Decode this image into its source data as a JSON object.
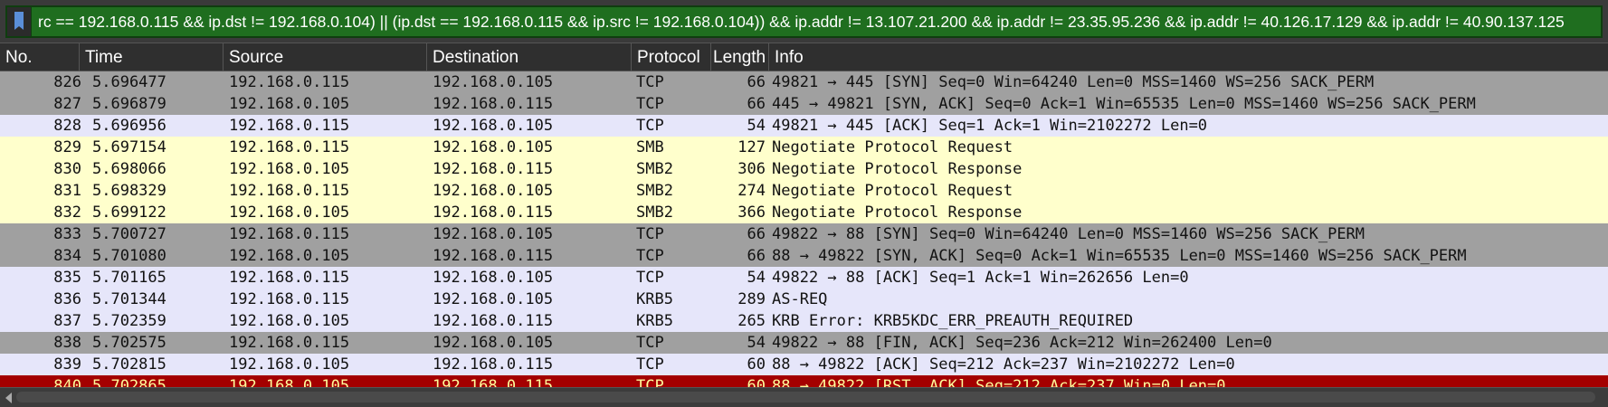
{
  "filter": {
    "text": "rc == 192.168.0.115 && ip.dst != 192.168.0.104) || (ip.dst == 192.168.0.115 && ip.src != 192.168.0.104)) && ip.addr != 13.107.21.200 && ip.addr != 23.35.95.236 && ip.addr != 40.126.17.129 && ip.addr != 40.90.137.125",
    "bookmark_icon": "bookmark-icon",
    "background_color": "#1f6e1f"
  },
  "columns": {
    "no": "No.",
    "time": "Time",
    "source": "Source",
    "destination": "Destination",
    "protocol": "Protocol",
    "length": "Length",
    "info": "Info"
  },
  "colors": {
    "tcp_gray": "#a0a0a0",
    "tcp_lavender": "#e6e6fa",
    "smb_yellow": "#ffffcc",
    "tcp_rst_red": "#a40000",
    "text_dark": "#121212",
    "text_light": "#fffc9c"
  },
  "packets": [
    {
      "no": "826",
      "time": "5.696477",
      "source": "192.168.0.115",
      "destination": "192.168.0.105",
      "protocol": "TCP",
      "length": "66",
      "info": "49821 → 445 [SYN] Seq=0 Win=64240 Len=0 MSS=1460 WS=256 SACK_PERM",
      "bg": "#a0a0a0",
      "fg": "#121212"
    },
    {
      "no": "827",
      "time": "5.696879",
      "source": "192.168.0.105",
      "destination": "192.168.0.115",
      "protocol": "TCP",
      "length": "66",
      "info": "445 → 49821 [SYN, ACK] Seq=0 Ack=1 Win=65535 Len=0 MSS=1460 WS=256 SACK_PERM",
      "bg": "#a0a0a0",
      "fg": "#121212"
    },
    {
      "no": "828",
      "time": "5.696956",
      "source": "192.168.0.115",
      "destination": "192.168.0.105",
      "protocol": "TCP",
      "length": "54",
      "info": "49821 → 445 [ACK] Seq=1 Ack=1 Win=2102272 Len=0",
      "bg": "#e6e6fa",
      "fg": "#121212"
    },
    {
      "no": "829",
      "time": "5.697154",
      "source": "192.168.0.115",
      "destination": "192.168.0.105",
      "protocol": "SMB",
      "length": "127",
      "info": "Negotiate Protocol Request",
      "bg": "#ffffcc",
      "fg": "#121212"
    },
    {
      "no": "830",
      "time": "5.698066",
      "source": "192.168.0.105",
      "destination": "192.168.0.115",
      "protocol": "SMB2",
      "length": "306",
      "info": "Negotiate Protocol Response",
      "bg": "#ffffcc",
      "fg": "#121212"
    },
    {
      "no": "831",
      "time": "5.698329",
      "source": "192.168.0.115",
      "destination": "192.168.0.105",
      "protocol": "SMB2",
      "length": "274",
      "info": "Negotiate Protocol Request",
      "bg": "#ffffcc",
      "fg": "#121212"
    },
    {
      "no": "832",
      "time": "5.699122",
      "source": "192.168.0.105",
      "destination": "192.168.0.115",
      "protocol": "SMB2",
      "length": "366",
      "info": "Negotiate Protocol Response",
      "bg": "#ffffcc",
      "fg": "#121212"
    },
    {
      "no": "833",
      "time": "5.700727",
      "source": "192.168.0.115",
      "destination": "192.168.0.105",
      "protocol": "TCP",
      "length": "66",
      "info": "49822 → 88 [SYN] Seq=0 Win=64240 Len=0 MSS=1460 WS=256 SACK_PERM",
      "bg": "#a0a0a0",
      "fg": "#121212"
    },
    {
      "no": "834",
      "time": "5.701080",
      "source": "192.168.0.105",
      "destination": "192.168.0.115",
      "protocol": "TCP",
      "length": "66",
      "info": "88 → 49822 [SYN, ACK] Seq=0 Ack=1 Win=65535 Len=0 MSS=1460 WS=256 SACK_PERM",
      "bg": "#a0a0a0",
      "fg": "#121212"
    },
    {
      "no": "835",
      "time": "5.701165",
      "source": "192.168.0.115",
      "destination": "192.168.0.105",
      "protocol": "TCP",
      "length": "54",
      "info": "49822 → 88 [ACK] Seq=1 Ack=1 Win=262656 Len=0",
      "bg": "#e6e6fa",
      "fg": "#121212"
    },
    {
      "no": "836",
      "time": "5.701344",
      "source": "192.168.0.115",
      "destination": "192.168.0.105",
      "protocol": "KRB5",
      "length": "289",
      "info": "AS-REQ",
      "bg": "#e6e6fa",
      "fg": "#121212"
    },
    {
      "no": "837",
      "time": "5.702359",
      "source": "192.168.0.105",
      "destination": "192.168.0.115",
      "protocol": "KRB5",
      "length": "265",
      "info": "KRB Error: KRB5KDC_ERR_PREAUTH_REQUIRED",
      "bg": "#e6e6fa",
      "fg": "#121212"
    },
    {
      "no": "838",
      "time": "5.702575",
      "source": "192.168.0.115",
      "destination": "192.168.0.105",
      "protocol": "TCP",
      "length": "54",
      "info": "49822 → 88 [FIN, ACK] Seq=236 Ack=212 Win=262400 Len=0",
      "bg": "#a0a0a0",
      "fg": "#121212"
    },
    {
      "no": "839",
      "time": "5.702815",
      "source": "192.168.0.105",
      "destination": "192.168.0.115",
      "protocol": "TCP",
      "length": "60",
      "info": "88 → 49822 [ACK] Seq=212 Ack=237 Win=2102272 Len=0",
      "bg": "#e6e6fa",
      "fg": "#121212"
    },
    {
      "no": "840",
      "time": "5.702865",
      "source": "192.168.0.105",
      "destination": "192.168.0.115",
      "protocol": "TCP",
      "length": "60",
      "info": "88 → 49822 [RST, ACK] Seq=212 Ack=237 Win=0 Len=0",
      "bg": "#a40000",
      "fg": "#fffc9c"
    }
  ]
}
